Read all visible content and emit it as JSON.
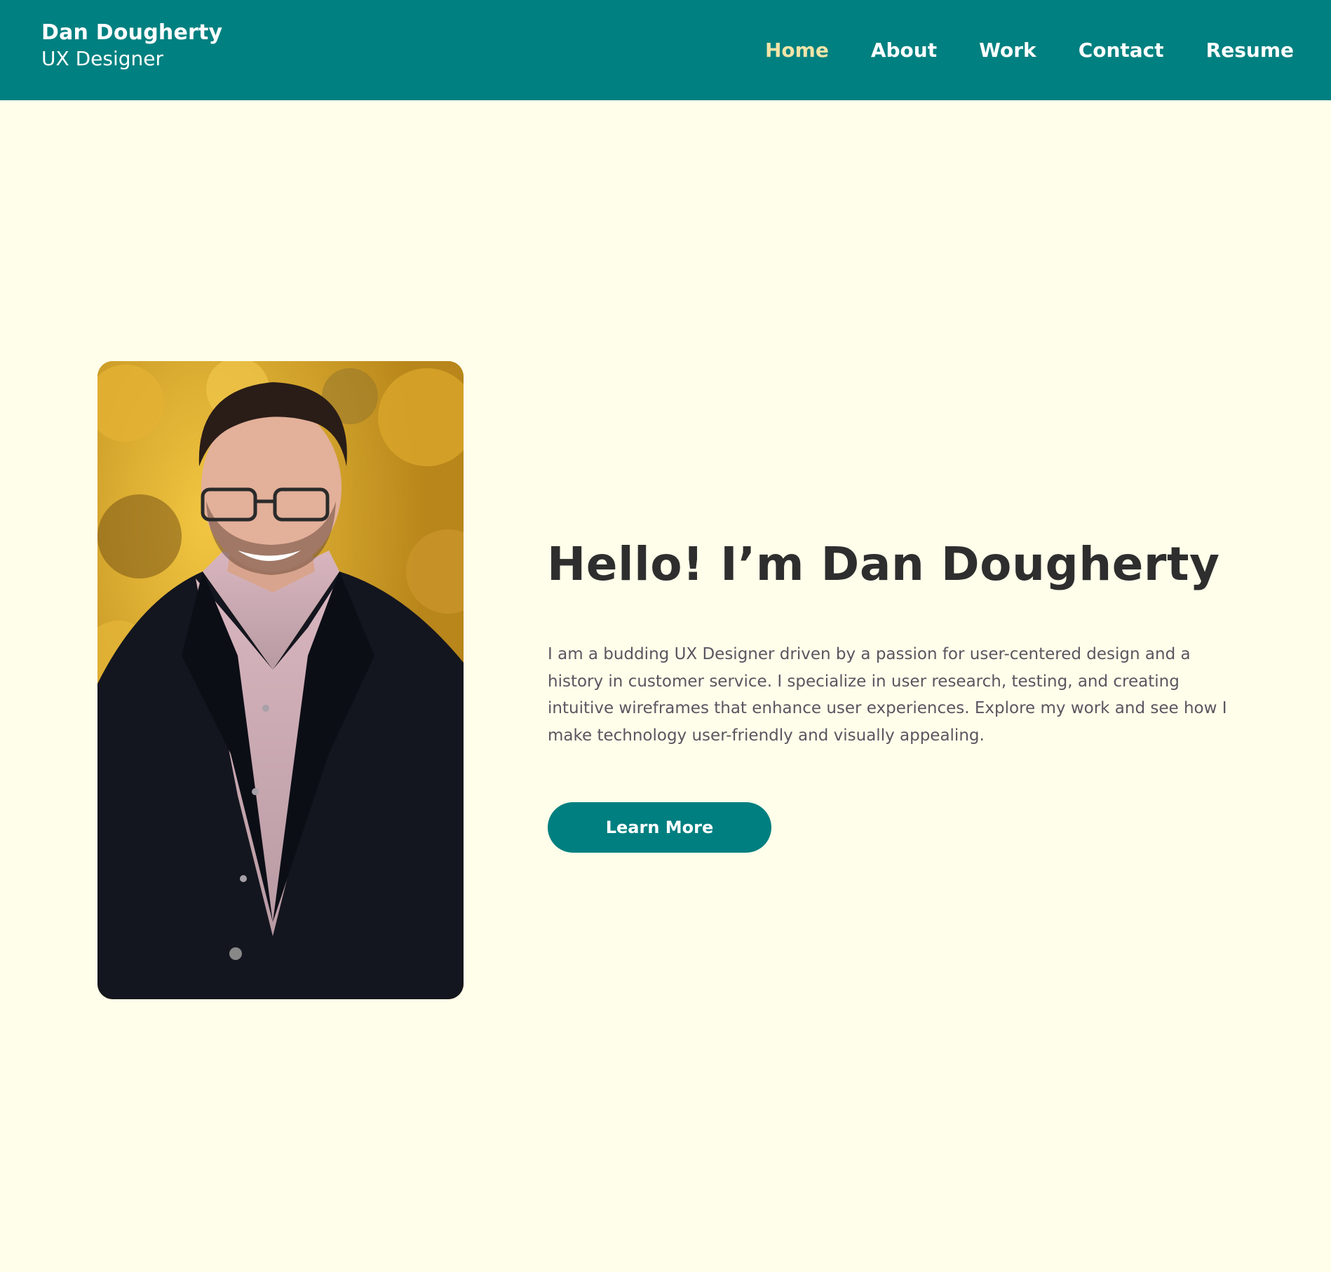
{
  "header": {
    "name": "Dan Dougherty",
    "role": "UX Designer",
    "nav": [
      {
        "label": "Home",
        "active": true
      },
      {
        "label": "About",
        "active": false
      },
      {
        "label": "Work",
        "active": false
      },
      {
        "label": "Contact",
        "active": false
      },
      {
        "label": "Resume",
        "active": false
      }
    ]
  },
  "hero": {
    "title": "Hello! I’m Dan Dougherty",
    "description": "I am a budding UX Designer driven by a passion for user-centered design and a history in customer service. I specialize in user research, testing, and creating intuitive wireframes that enhance user experiences. Explore my work and see how I make technology user-friendly and visually appealing.",
    "cta_label": "Learn More"
  },
  "colors": {
    "header_bg": "#008080",
    "page_bg": "#fefeea",
    "active_nav": "#f2e4a8",
    "button_bg": "#007f80",
    "title_text": "#2e2e2e",
    "body_text": "#5a5660"
  }
}
